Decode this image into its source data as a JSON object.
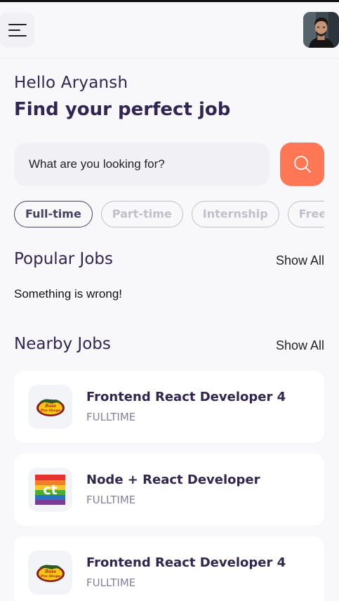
{
  "header": {
    "menu_icon": "hamburger-menu-icon",
    "avatar_icon": "profile-photo"
  },
  "welcome": {
    "greeting": "Hello Aryansh",
    "headline": "Find your perfect job"
  },
  "search": {
    "placeholder": "What are you looking for?",
    "button_icon": "search-icon"
  },
  "job_types": [
    {
      "label": "Full-time",
      "active": true
    },
    {
      "label": "Part-time",
      "active": false
    },
    {
      "label": "Internship",
      "active": false
    },
    {
      "label": "Freelance",
      "active": false
    }
  ],
  "popular": {
    "title": "Popular Jobs",
    "show_all": "Show All",
    "error": "Something is wrong!"
  },
  "nearby": {
    "title": "Nearby Jobs",
    "show_all": "Show All",
    "jobs": [
      {
        "title": "Frontend React Developer 4",
        "type": "FULLTIME",
        "logo": "bass-pro-shops-logo"
      },
      {
        "title": "Node + React Developer",
        "type": "FULLTIME",
        "logo": "ct-rainbow-logo"
      },
      {
        "title": "Frontend React Developer 4",
        "type": "FULLTIME",
        "logo": "bass-pro-shops-logo"
      }
    ]
  },
  "colors": {
    "primary": "#312651",
    "accent": "#ff7754",
    "gray": "#83829a",
    "background": "#f8f8fb"
  }
}
